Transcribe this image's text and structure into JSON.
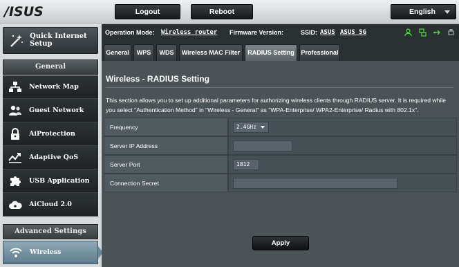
{
  "header": {
    "logo": "/ISUS",
    "logout_label": "Logout",
    "reboot_label": "Reboot",
    "language_label": "English"
  },
  "sidebar": {
    "quick_setup_label": "Quick Internet Setup",
    "general_header": "General",
    "items": [
      {
        "label": "Network Map",
        "icon": "network-map-icon"
      },
      {
        "label": "Guest Network",
        "icon": "guest-network-icon"
      },
      {
        "label": "AiProtection",
        "icon": "lock-icon"
      },
      {
        "label": "Adaptive QoS",
        "icon": "qos-icon"
      },
      {
        "label": "USB Application",
        "icon": "puzzle-icon"
      },
      {
        "label": "AiCloud 2.0",
        "icon": "cloud-icon"
      }
    ],
    "advanced_header": "Advanced Settings",
    "active_item_label": "Wireless"
  },
  "infobar": {
    "op_mode_label": "Operation Mode:",
    "op_mode_value": "Wireless router",
    "firmware_label": "Firmware Version:",
    "ssid_label": "SSID:",
    "ssid_value_1": "ASUS",
    "ssid_value_2": "ASUS_5G"
  },
  "tabs": [
    {
      "label": "General"
    },
    {
      "label": "WPS"
    },
    {
      "label": "WDS"
    },
    {
      "label": "Wireless MAC Filter"
    },
    {
      "label": "RADIUS Setting"
    },
    {
      "label": "Professional"
    }
  ],
  "content": {
    "title": "Wireless - RADIUS Setting",
    "description": "This section allows you to set up additional parameters for authorizing wireless clients through RADIUS server. It is required while you select \"Authentication Method\" in \"Wireless - General\" as \"WPA-Enterprise/ WPA2-Enterprise/ Radius with 802.1x\".",
    "form": {
      "frequency_label": "Frequency",
      "frequency_value": "2.4GHz",
      "server_ip_label": "Server IP Address",
      "server_ip_value": "",
      "server_port_label": "Server Port",
      "server_port_value": "1812",
      "secret_label": "Connection Secret",
      "secret_value": ""
    },
    "apply_label": "Apply"
  }
}
